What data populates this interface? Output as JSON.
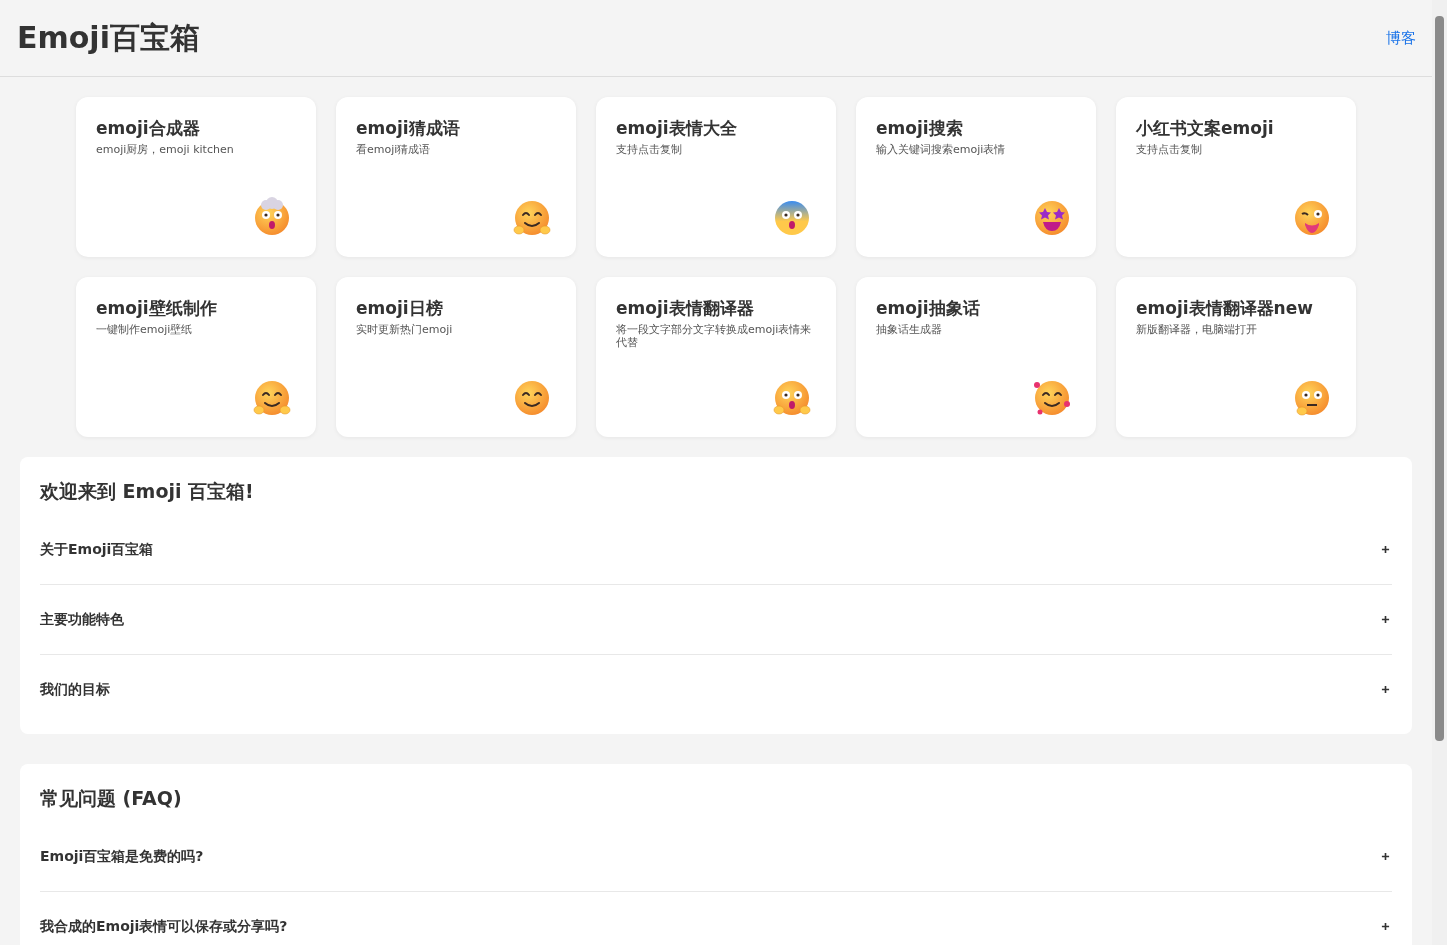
{
  "header": {
    "title": "Emoji百宝箱",
    "link": "博客"
  },
  "tools": [
    {
      "title": "emoji合成器",
      "desc": "emoji厨房，emoji kitchen"
    },
    {
      "title": "emoji猜成语",
      "desc": "看emoji猜成语"
    },
    {
      "title": "emoji表情大全",
      "desc": "支持点击复制"
    },
    {
      "title": "emoji搜索",
      "desc": "输入关键词搜索emoji表情"
    },
    {
      "title": "小红书文案emoji",
      "desc": "支持点击复制"
    },
    {
      "title": "emoji壁纸制作",
      "desc": "一键制作emoji壁纸"
    },
    {
      "title": "emoji日榜",
      "desc": "实时更新热门emoji"
    },
    {
      "title": "emoji表情翻译器",
      "desc": "将一段文字部分文字转换成emoji表情来代替"
    },
    {
      "title": "emoji抽象话",
      "desc": "抽象话生成器"
    },
    {
      "title": "emoji表情翻译器new",
      "desc": "新版翻译器，电脑端打开"
    }
  ],
  "sections": [
    {
      "heading": "欢迎来到 Emoji 百宝箱!",
      "items": [
        "关于Emoji百宝箱",
        "主要功能特色",
        "我们的目标"
      ]
    },
    {
      "heading": "常见问题 (FAQ)",
      "items": [
        "Emoji百宝箱是免费的吗?",
        "我合成的Emoji表情可以保存或分享吗?"
      ]
    }
  ]
}
